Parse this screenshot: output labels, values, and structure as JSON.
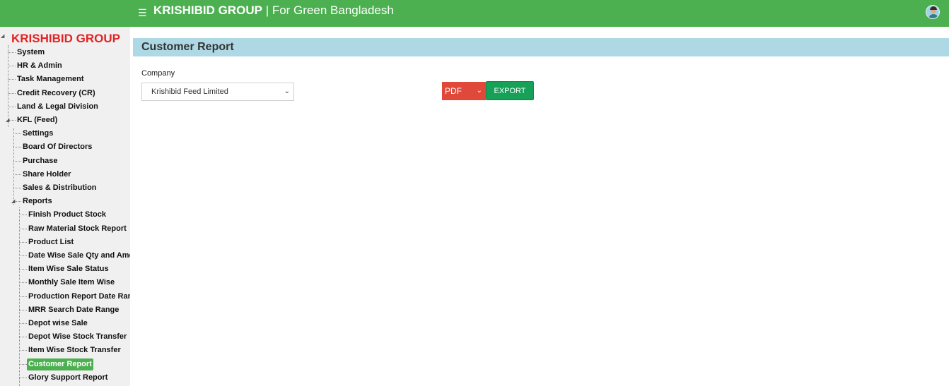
{
  "header": {
    "menu_icon": "☰",
    "brand_bold": "KRISHIBID GROUP",
    "brand_rest": " | For Green Bangladesh",
    "avatar_icon": "user-avatar"
  },
  "sidebar": {
    "root": "KRISHIBID GROUP",
    "items": [
      {
        "label": "System"
      },
      {
        "label": "HR & Admin"
      },
      {
        "label": "Task Management"
      },
      {
        "label": "Credit Recovery (CR)"
      },
      {
        "label": "Land & Legal Division"
      },
      {
        "label": "KFL (Feed)"
      }
    ],
    "kfl_children": [
      {
        "label": "Settings"
      },
      {
        "label": "Board Of Directors"
      },
      {
        "label": "Purchase"
      },
      {
        "label": "Share Holder"
      },
      {
        "label": "Sales & Distribution"
      },
      {
        "label": "Reports"
      }
    ],
    "reports": [
      {
        "label": "Finish Product Stock"
      },
      {
        "label": "Raw Material Stock Report"
      },
      {
        "label": "Product List"
      },
      {
        "label": "Date Wise Sale Qty and Amount"
      },
      {
        "label": "Item Wise Sale Status"
      },
      {
        "label": "Monthly Sale Item Wise"
      },
      {
        "label": "Production Report Date Range"
      },
      {
        "label": "MRR Search Date Range"
      },
      {
        "label": "Depot wise Sale"
      },
      {
        "label": "Depot Wise Stock Transfer"
      },
      {
        "label": "Item Wise Stock Transfer"
      },
      {
        "label": "Customer Report"
      },
      {
        "label": "Glory Support Report"
      }
    ]
  },
  "main": {
    "title": "Customer Report",
    "company_label": "Company",
    "company_value": "Krishibid Feed Limited",
    "format_value": "PDF",
    "export_label": "EXPORT"
  },
  "colors": {
    "brand_green": "#4cb050",
    "title_bar": "#add8e4",
    "root_red": "#e02424",
    "pdf_red": "#e0493a",
    "export_green": "#16a058"
  }
}
